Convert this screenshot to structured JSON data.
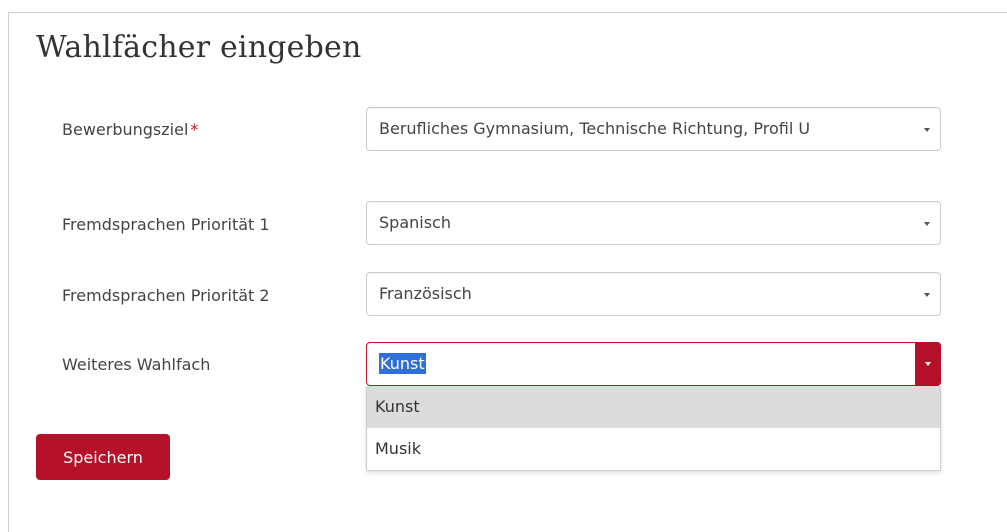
{
  "form": {
    "title": "Wahlfächer eingeben",
    "required_marker": "*",
    "fields": [
      {
        "label": "Bewerbungsziel",
        "value": "Berufliches Gymnasium, Technische Richtung, Profil U",
        "required": true
      },
      {
        "label": "Fremdsprachen Priorität 1",
        "value": "Spanisch",
        "required": false
      },
      {
        "label": "Fremdsprachen Priorität 2",
        "value": "Französisch",
        "required": false
      },
      {
        "label": "Weiteres Wahlfach",
        "value": "Kunst",
        "required": false,
        "open": true
      }
    ],
    "dropdown_options": [
      "Kunst",
      "Musik"
    ],
    "highlighted_option": "Kunst",
    "save_label": "Speichern"
  },
  "colors": {
    "accent": "#b5122a",
    "selection": "#2f6fd6",
    "option_highlight": "#dcdcdc"
  }
}
